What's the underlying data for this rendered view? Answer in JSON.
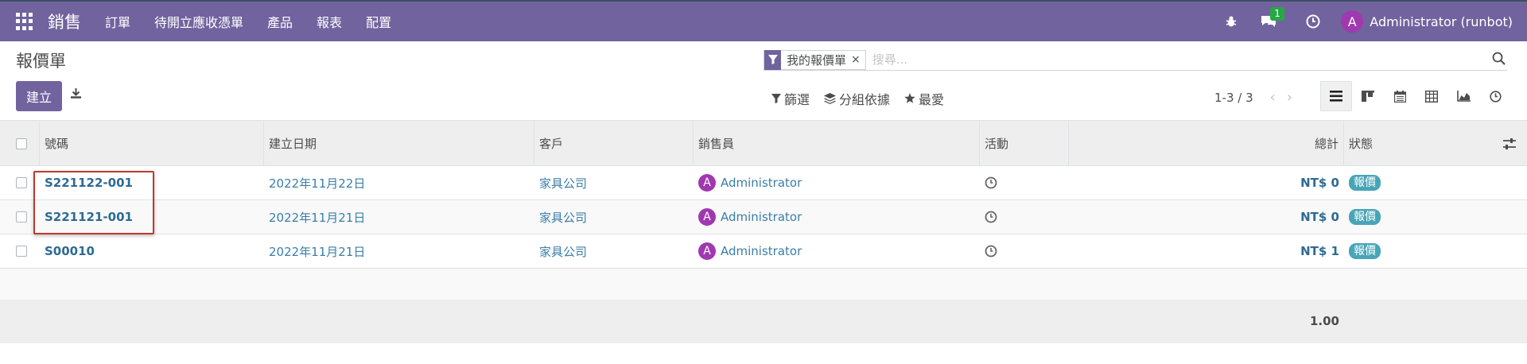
{
  "navbar": {
    "app_name": "銷售",
    "menu": [
      "訂單",
      "待開立應收憑單",
      "產品",
      "報表",
      "配置"
    ],
    "chat_badge": "1",
    "user_initial": "A",
    "user_name": "Administrator (runbot)",
    "bg_color": "#71639e"
  },
  "control_panel": {
    "title": "報價單",
    "facet_label": "我的報價單",
    "search_placeholder": "搜尋...",
    "create_label": "建立",
    "filters": [
      "篩選",
      "分組依據",
      "最愛"
    ],
    "pager_value": "1-3 / 3",
    "views": [
      "list-icon",
      "kanban-icon",
      "calendar-icon",
      "pivot-icon",
      "graph-icon",
      "activity-icon"
    ]
  },
  "table": {
    "headers": [
      "號碼",
      "建立日期",
      "客戶",
      "銷售員",
      "活動",
      "總計",
      "狀態"
    ],
    "rows": [
      {
        "number": "S221122-001",
        "date": "2022年11月22日",
        "customer": "家具公司",
        "avatar": "A",
        "salesperson": "Administrator",
        "total": "NT$ 0",
        "status": "報價"
      },
      {
        "number": "S221121-001",
        "date": "2022年11月21日",
        "customer": "家具公司",
        "avatar": "A",
        "salesperson": "Administrator",
        "total": "NT$ 0",
        "status": "報價"
      },
      {
        "number": "S00010",
        "date": "2022年11月21日",
        "customer": "家具公司",
        "avatar": "A",
        "salesperson": "Administrator",
        "total": "NT$ 1",
        "status": "報價"
      }
    ],
    "footer_total": "1.00"
  }
}
